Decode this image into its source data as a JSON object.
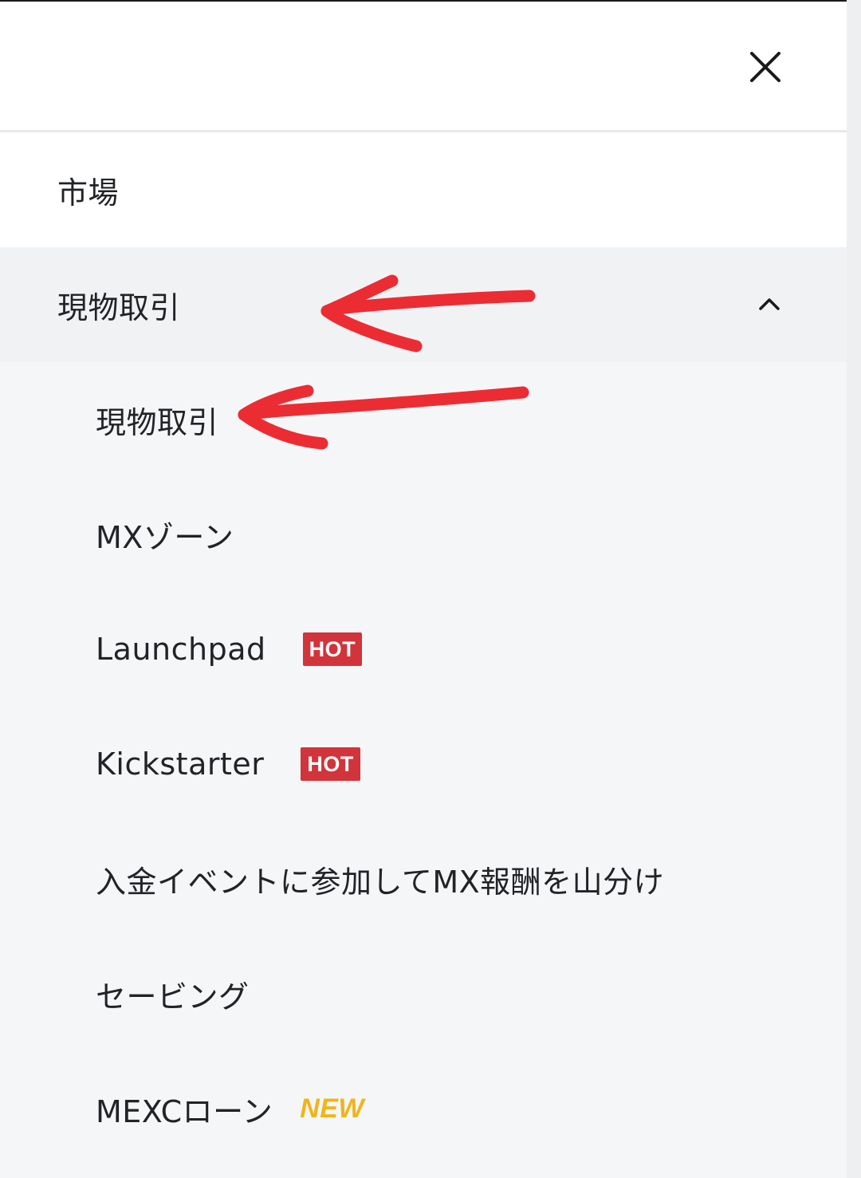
{
  "drawer": {
    "close_icon": "close-icon"
  },
  "menu": {
    "markets": {
      "label": "市場"
    },
    "spot": {
      "label": "現物取引",
      "expanded": true,
      "chevron_icon": "chevron-up-icon"
    }
  },
  "submenu": {
    "items": [
      {
        "label": "現物取引"
      },
      {
        "label": "MXゾーン"
      },
      {
        "label": "Launchpad",
        "badge": "HOT"
      },
      {
        "label": "Kickstarter",
        "badge": "HOT"
      },
      {
        "label": "入金イベントに参加してMX報酬を山分け"
      },
      {
        "label": "セービング"
      },
      {
        "label": "MEXCローン",
        "badge": "NEW"
      }
    ]
  },
  "colors": {
    "hot_badge": "#d1343a",
    "new_badge": "#f0b51b",
    "annotation_arrow": "#ec2c33"
  }
}
